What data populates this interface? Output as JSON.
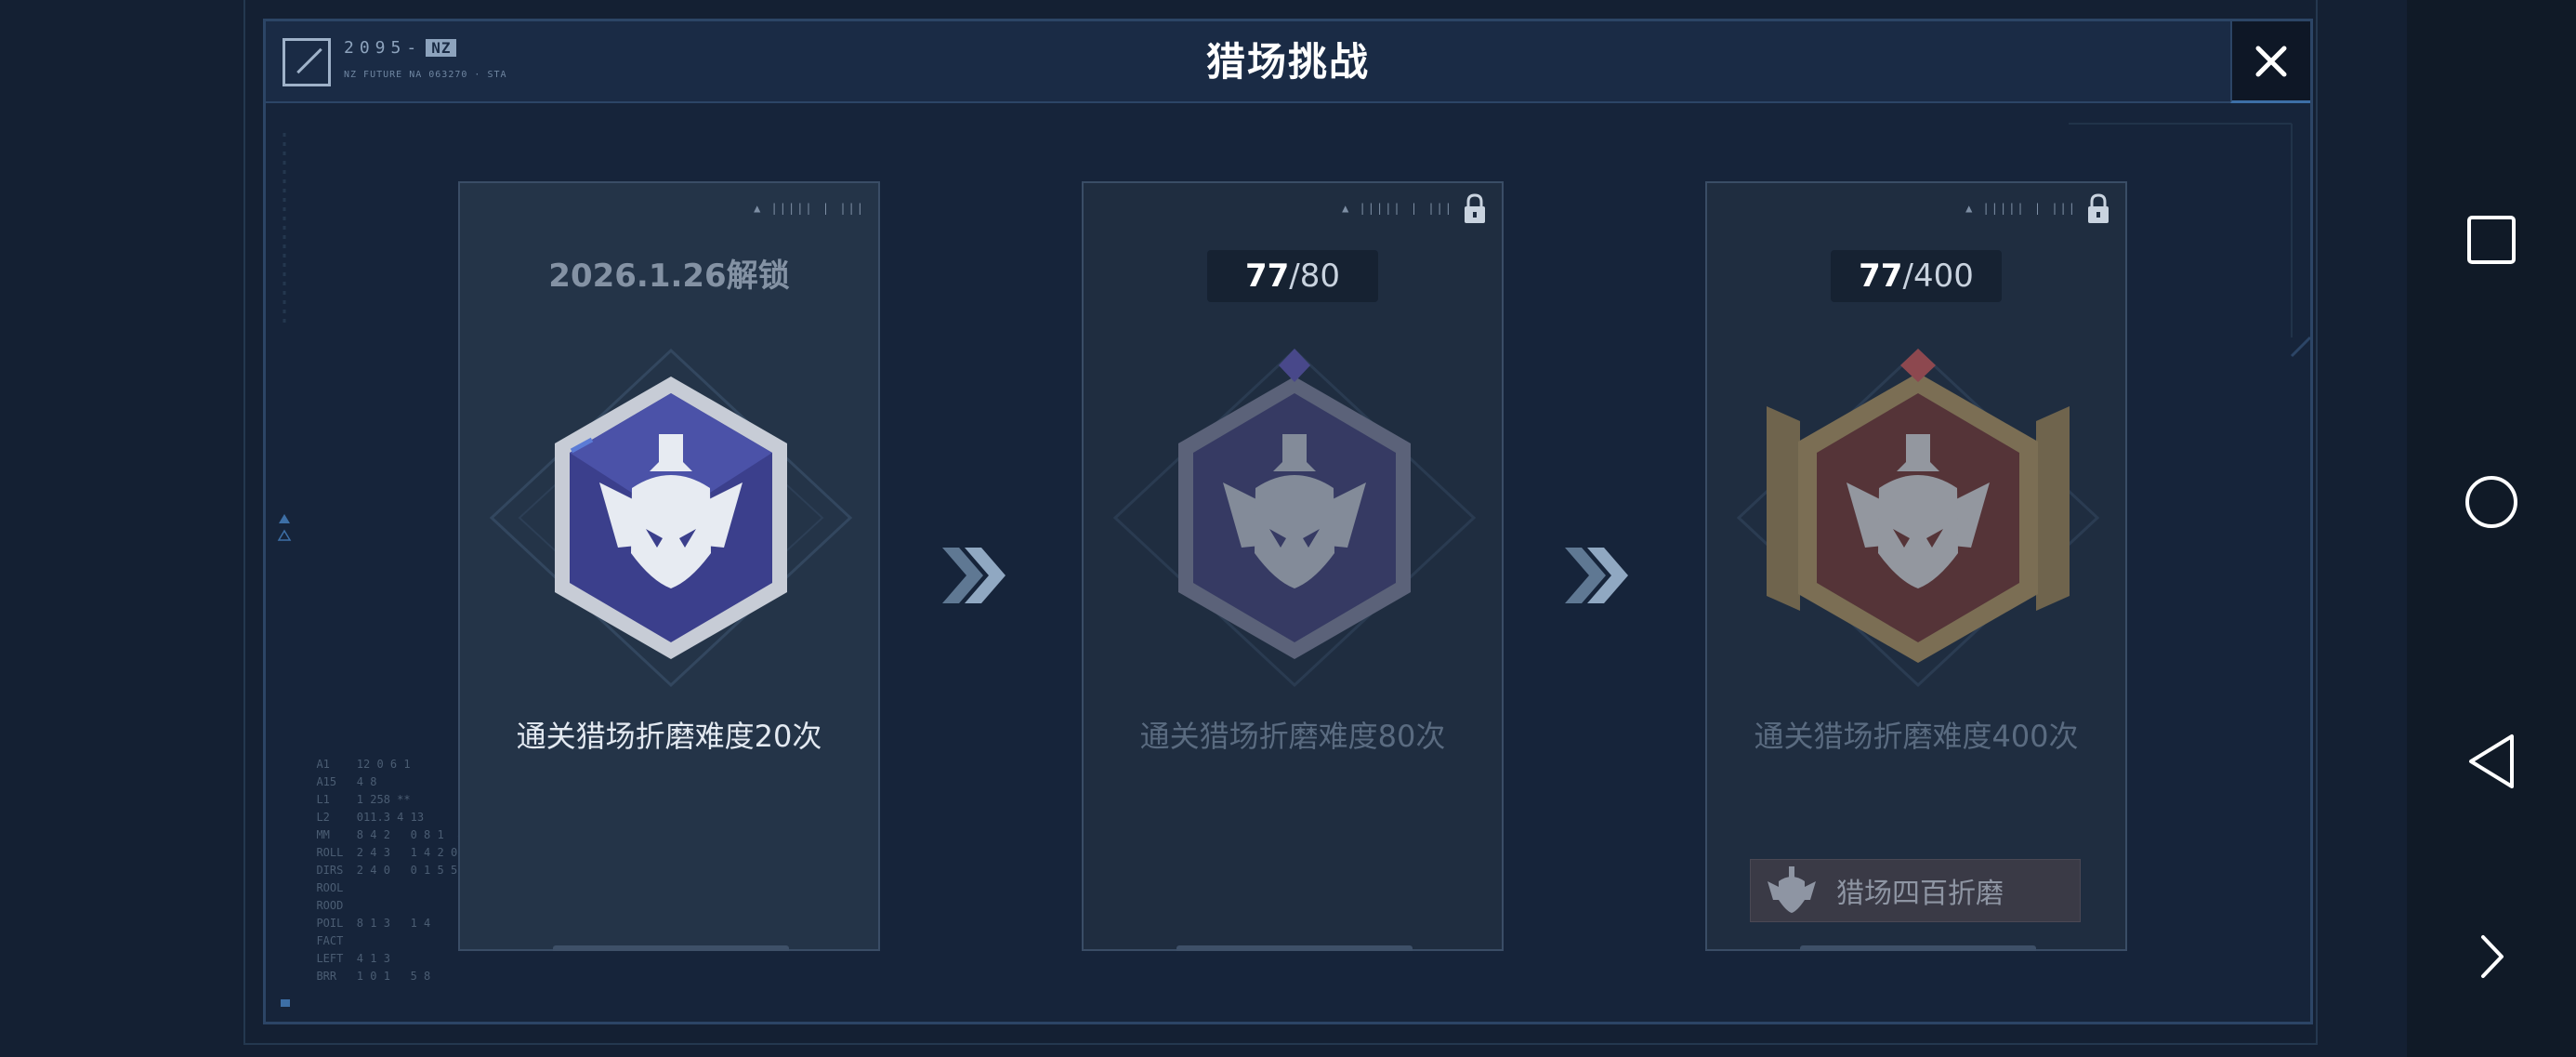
{
  "header": {
    "title": "猎场挑战",
    "logo_text": "2095-",
    "logo_badge": "NZ",
    "logo_sub": "NZ FUTURE NA 063270 · STA"
  },
  "cards": [
    {
      "status": "unlocked",
      "header_text": "2026.1.26解锁",
      "description": "通关猎场折磨难度20次",
      "badge_color": "#3b3f8c"
    },
    {
      "status": "locked",
      "progress_current": "77",
      "progress_sep": "/",
      "progress_goal": "80",
      "description": "通关猎场折磨难度80次",
      "badge_color": "#4a4680"
    },
    {
      "status": "locked",
      "progress_current": "77",
      "progress_sep": "/",
      "progress_goal": "400",
      "description": "通关猎场折磨难度400次",
      "badge_color": "#7a3a34",
      "reward_text": "猎场四百折磨"
    }
  ],
  "colors": {
    "panel_bg": "#16243a",
    "panel_border": "#2c4566",
    "accent_blue": "#3d6fa6"
  },
  "icons": {
    "close": "close-icon",
    "lock": "lock-icon",
    "arrow": "double-chevron-right-icon",
    "square": "recent-apps-icon",
    "circle": "home-icon",
    "triangle": "back-icon",
    "chevron": "chevron-right-icon"
  }
}
